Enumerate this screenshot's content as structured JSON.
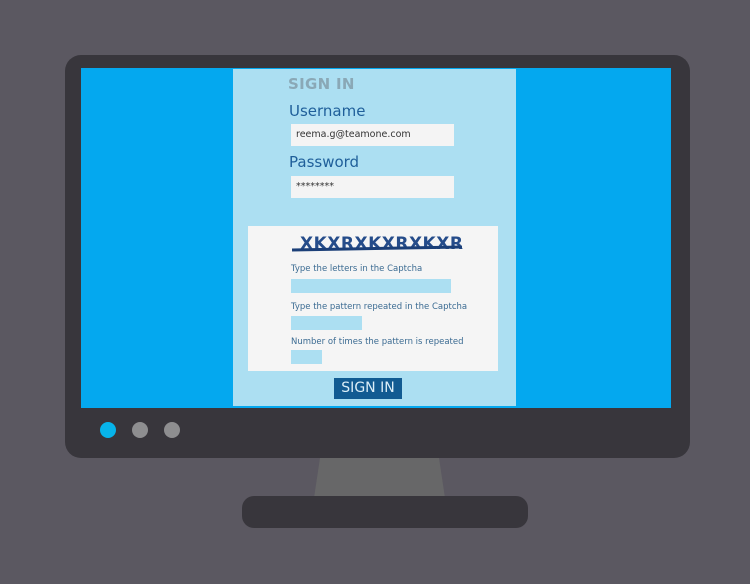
{
  "login": {
    "title": "SIGN IN",
    "username_label": "Username",
    "username_value": "reema.g@teamone.com",
    "password_label": "Password",
    "password_value": "********"
  },
  "captcha": {
    "text": "XKXRXKXRXKXR",
    "letters_label": "Type the letters in the Captcha",
    "pattern_label": "Type the pattern repeated in the Captcha",
    "count_label": "Number of times the pattern is repeated"
  },
  "buttons": {
    "signin": "SIGN IN"
  },
  "colors": {
    "screen": "#04a8ef",
    "panel": "#acdff2",
    "button": "#125b92",
    "active_dot": "#07b4ea",
    "inactive_dot": "#8e8e90"
  },
  "indicators": [
    "active",
    "inactive",
    "inactive"
  ]
}
